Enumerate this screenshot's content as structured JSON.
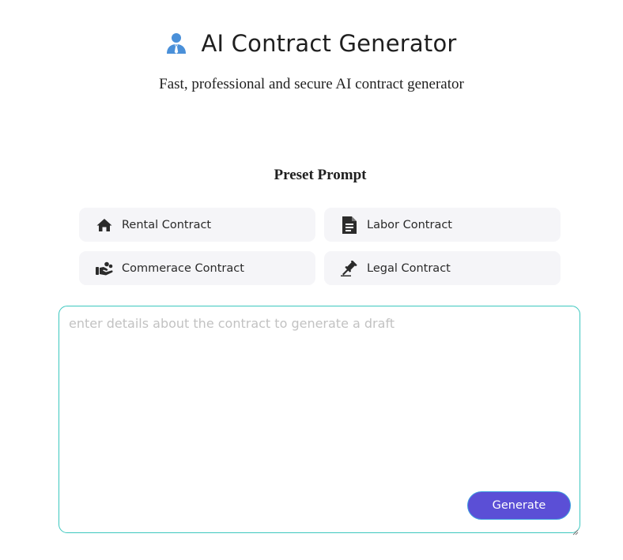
{
  "header": {
    "title": "AI Contract Generator",
    "subtitle": "Fast, professional and secure AI contract generator",
    "icon": "user-tie-icon",
    "icon_color": "#4a90d9"
  },
  "presets": {
    "heading": "Preset Prompt",
    "items": [
      {
        "label": "Rental Contract",
        "icon": "house-icon"
      },
      {
        "label": "Labor Contract",
        "icon": "document-icon"
      },
      {
        "label": "Commerace Contract",
        "icon": "handshake-icon"
      },
      {
        "label": "Legal Contract",
        "icon": "gavel-icon"
      }
    ]
  },
  "editor": {
    "placeholder": "enter details about the contract to generate a draft",
    "value": "",
    "border_color": "#3cc7bf"
  },
  "actions": {
    "generate_label": "Generate",
    "generate_color": "#5b4fd6"
  }
}
